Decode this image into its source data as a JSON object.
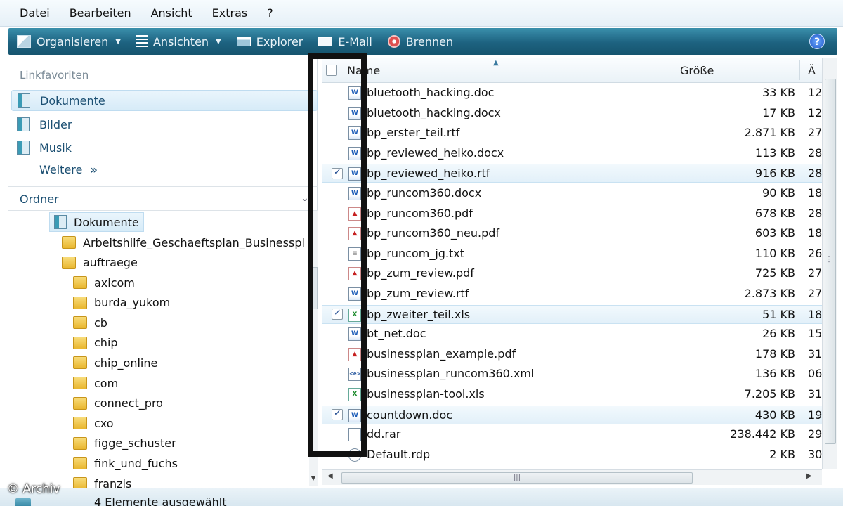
{
  "menu": [
    "Datei",
    "Bearbeiten",
    "Ansicht",
    "Extras",
    "?"
  ],
  "toolbar": {
    "organize": "Organisieren",
    "views": "Ansichten",
    "explorer": "Explorer",
    "email": "E-Mail",
    "burn": "Brennen",
    "help": "?"
  },
  "nav": {
    "favorites_header": "Linkfavoriten",
    "favorites": [
      "Dokumente",
      "Bilder",
      "Musik"
    ],
    "more": "Weitere",
    "more_chevron": "»",
    "folders_header": "Ordner",
    "root": "Dokumente",
    "tree_level1": [
      "Arbeitshilfe_Geschaeftsplan_Businesspl",
      "auftraege"
    ],
    "tree_level2": [
      "axicom",
      "burda_yukom",
      "cb",
      "chip",
      "chip_online",
      "com",
      "connect_pro",
      "cxo",
      "figge_schuster",
      "fink_und_fuchs",
      "franzis"
    ]
  },
  "columns": {
    "name": "Name",
    "size": "Größe",
    "date": "Ä"
  },
  "files": [
    {
      "name": "bluetooth_hacking.doc",
      "size": "33 KB",
      "type": "word",
      "checked": false,
      "date": "12"
    },
    {
      "name": "bluetooth_hacking.docx",
      "size": "17 KB",
      "type": "word",
      "checked": false,
      "date": "12"
    },
    {
      "name": "bp_erster_teil.rtf",
      "size": "2.871 KB",
      "type": "word",
      "checked": false,
      "date": "27"
    },
    {
      "name": "bp_reviewed_heiko.docx",
      "size": "113 KB",
      "type": "word",
      "checked": false,
      "date": "28"
    },
    {
      "name": "bp_reviewed_heiko.rtf",
      "size": "916 KB",
      "type": "word",
      "checked": true,
      "date": "28"
    },
    {
      "name": "bp_runcom360.docx",
      "size": "90 KB",
      "type": "word",
      "checked": false,
      "date": "18"
    },
    {
      "name": "bp_runcom360.pdf",
      "size": "678 KB",
      "type": "pdf",
      "checked": false,
      "date": "28"
    },
    {
      "name": "bp_runcom360_neu.pdf",
      "size": "603 KB",
      "type": "pdf",
      "checked": false,
      "date": "18"
    },
    {
      "name": "bp_runcom_jg.txt",
      "size": "110 KB",
      "type": "txt",
      "checked": false,
      "date": "26"
    },
    {
      "name": "bp_zum_review.pdf",
      "size": "725 KB",
      "type": "pdf",
      "checked": false,
      "date": "27"
    },
    {
      "name": "bp_zum_review.rtf",
      "size": "2.873 KB",
      "type": "word",
      "checked": false,
      "date": "27"
    },
    {
      "name": "bp_zweiter_teil.xls",
      "size": "51 KB",
      "type": "xls",
      "checked": true,
      "date": "18"
    },
    {
      "name": "bt_net.doc",
      "size": "26 KB",
      "type": "word",
      "checked": false,
      "date": "15"
    },
    {
      "name": "businessplan_example.pdf",
      "size": "178 KB",
      "type": "pdf",
      "checked": false,
      "date": "31"
    },
    {
      "name": "businessplan_runcom360.xml",
      "size": "136 KB",
      "type": "xml",
      "checked": false,
      "date": "06"
    },
    {
      "name": "businessplan-tool.xls",
      "size": "7.205 KB",
      "type": "xls",
      "checked": false,
      "date": "31"
    },
    {
      "name": "countdown.doc",
      "size": "430 KB",
      "type": "word",
      "checked": true,
      "date": "19"
    },
    {
      "name": "dd.rar",
      "size": "238.442 KB",
      "type": "rar",
      "checked": false,
      "date": "29"
    },
    {
      "name": "Default.rdp",
      "size": "2 KB",
      "type": "rdp",
      "checked": false,
      "date": "30"
    }
  ],
  "status": "4 Elemente ausgewählt",
  "watermark": "© Archiv"
}
